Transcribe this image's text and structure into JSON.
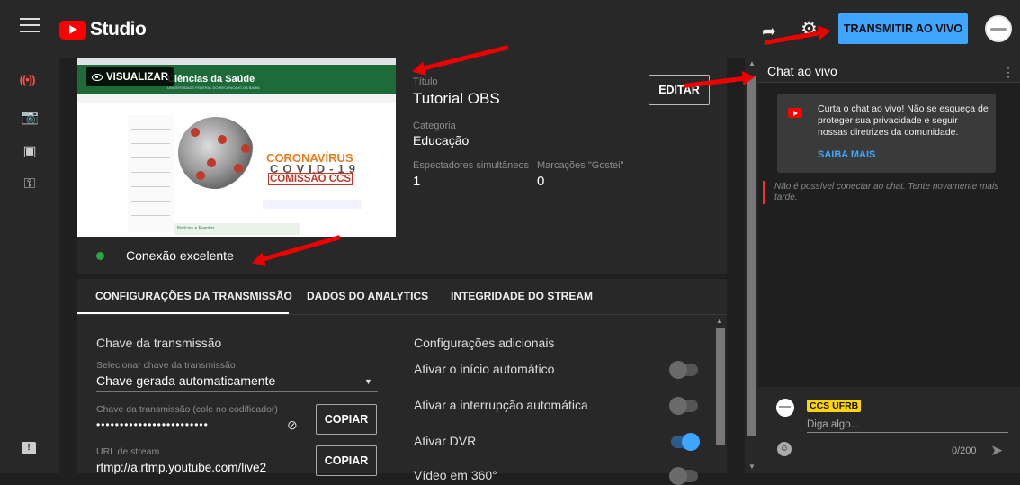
{
  "app": {
    "brand": "Studio",
    "live_button": "TRANSMITIR AO VIVO"
  },
  "icons": {
    "menu": "menu-icon",
    "share": "share-icon",
    "settings": "gear-icon",
    "live": "live-broadcast-icon",
    "camera": "camera-icon",
    "calendar": "calendar-icon",
    "manage": "manage-icon",
    "feedback": "feedback-icon"
  },
  "preview": {
    "view_label": "VISUALIZAR",
    "site_title": "Ciências da Saúde",
    "site_subtitle": "UNIVERSIDADE FEDERAL DO RECÔNCAVO DA BAHIA",
    "covid_line1": "CORONAVÍRUS",
    "covid_line2": "COVID-19",
    "covid_line3": "COMISSÃO CCS",
    "news": "Notícias e Eventos"
  },
  "stream": {
    "title_label": "Título",
    "title": "Tutorial OBS",
    "category_label": "Categoria",
    "category": "Educação",
    "viewers_label": "Espectadores simultâneos",
    "viewers": "1",
    "likes_label": "Marcações \"Gostei\"",
    "likes": "0",
    "edit_button": "EDITAR",
    "connection": "Conexão excelente"
  },
  "tabs": [
    "CONFIGURAÇÕES DA TRANSMISSÃO",
    "DADOS DO ANALYTICS",
    "INTEGRIDADE DO STREAM"
  ],
  "settings": {
    "key_heading": "Chave da transmissão",
    "select_label": "Selecionar chave da transmissão",
    "select_value": "Chave gerada automaticamente",
    "key_label": "Chave da transmissão (cole no codificador)",
    "key_value": "••••••••••••••••••••••••",
    "copy": "COPIAR",
    "url_label": "URL de stream",
    "url_value": "rtmp://a.rtmp.youtube.com/live2",
    "extra_heading": "Configurações adicionais",
    "options": [
      {
        "label": "Ativar o início automático",
        "on": false
      },
      {
        "label": "Ativar a interrupção automática",
        "on": false
      },
      {
        "label": "Ativar DVR",
        "on": true
      },
      {
        "label": "Vídeo em 360°",
        "on": false
      }
    ]
  },
  "chat": {
    "title": "Chat ao vivo",
    "card_text": "Curta o chat ao vivo! Não se esqueça de proteger sua privacidade e seguir nossas diretrizes da comunidade.",
    "card_link": "SAIBA MAIS",
    "error": "Não é possível conectar ao chat. Tente novamente mais tarde.",
    "user": "CCS UFRB",
    "placeholder": "Diga algo...",
    "count": "0/200"
  }
}
